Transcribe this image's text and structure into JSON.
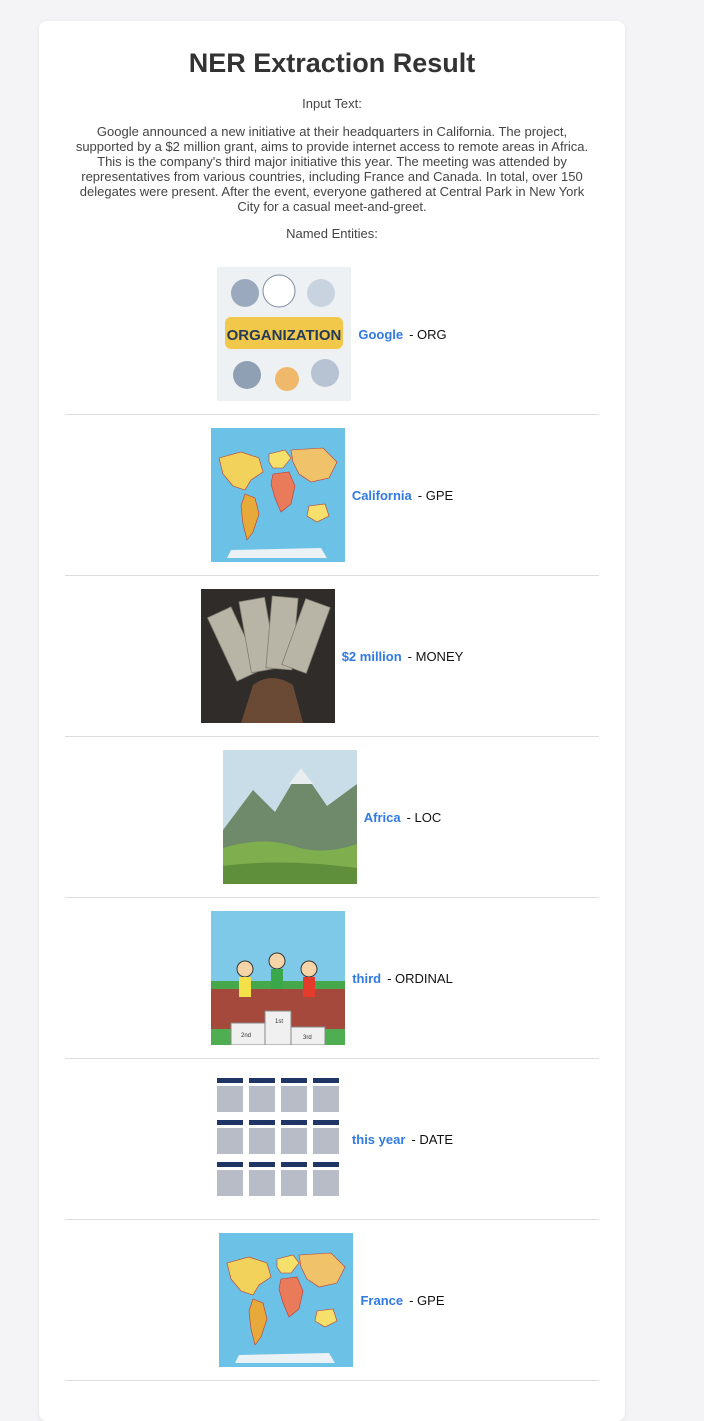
{
  "page": {
    "title": "NER Extraction Result",
    "input_label": "Input Text:",
    "input_text": "Google announced a new initiative at their headquarters in California. The project, supported by a $2 million grant, aims to provide internet access to remote areas in Africa. This is the company's third major initiative this year. The meeting was attended by representatives from various countries, including France and Canada. In total, over 150 delegates were present. After the event, everyone gathered at Central Park in New York City for a casual meet-and-greet.",
    "entities_label": "Named Entities:"
  },
  "entities": [
    {
      "text": "Google",
      "label": "- ORG",
      "image_text": "ORGANIZATION"
    },
    {
      "text": "California",
      "label": "- GPE"
    },
    {
      "text": "$2 million",
      "label": "- MONEY"
    },
    {
      "text": "Africa",
      "label": "- LOC"
    },
    {
      "text": "third",
      "label": "- ORDINAL",
      "image_text": [
        "1st",
        "2nd",
        "3rd"
      ]
    },
    {
      "text": "this year",
      "label": "- DATE"
    },
    {
      "text": "France",
      "label": "- GPE"
    }
  ],
  "colors": {
    "entity_link": "#2f7ae5",
    "divider": "#dddddd",
    "background": "#f4f4f7"
  }
}
